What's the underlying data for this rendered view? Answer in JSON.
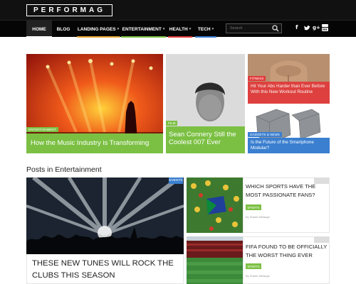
{
  "site": {
    "logo": "PERFORMAG"
  },
  "nav": {
    "items": [
      {
        "label": "HOME",
        "has_dropdown": false,
        "underline": "#ffffff"
      },
      {
        "label": "BLOG",
        "has_dropdown": false,
        "underline": "#ffffff"
      },
      {
        "label": "LANDING PAGES",
        "has_dropdown": true,
        "underline": "#e8a736"
      },
      {
        "label": "ENTERTAINMENT",
        "has_dropdown": true,
        "underline": "#7bc043"
      },
      {
        "label": "HEALTH",
        "has_dropdown": true,
        "underline": "#e03b3b"
      },
      {
        "label": "TECH",
        "has_dropdown": true,
        "underline": "#3a7fd0"
      }
    ],
    "search_placeholder": "Search",
    "social": [
      "f",
      "t",
      "g+",
      "yt"
    ]
  },
  "featured": [
    {
      "category": "ENTERTAINMENT",
      "title": "How the Music Industry is Transforming",
      "color": "#7bc043"
    },
    {
      "category": "FILM",
      "title": "Sean Connery Still the Coolest 007 Ever",
      "color": "#7bc043"
    },
    {
      "category": "FITNESS",
      "title": "Hit Your Abs Harder than Ever Before With this New Workout Routine",
      "color": "#e03b3b"
    },
    {
      "category": "GADGETS & NEWS",
      "title": "Is the Future of the Smartphone Modular?",
      "color": "#3a7fd0"
    }
  ],
  "section": {
    "title": "Posts in Entertainment",
    "main_post": {
      "category": "EVENTS",
      "title": "THESE NEW TUNES WILL ROCK THE CLUBS THIS SEASON"
    },
    "side_posts": [
      {
        "title": "WHICH SPORTS HAVE THE MOST PASSIONATE FANS?",
        "tag": "SPORTS",
        "byline": "By Shane Melaugh"
      },
      {
        "title": "FIFA FOUND TO BE OFFICIALLY THE WORST THING EVER",
        "tag": "SPORTS",
        "byline": "By Shane Melaugh"
      }
    ]
  }
}
